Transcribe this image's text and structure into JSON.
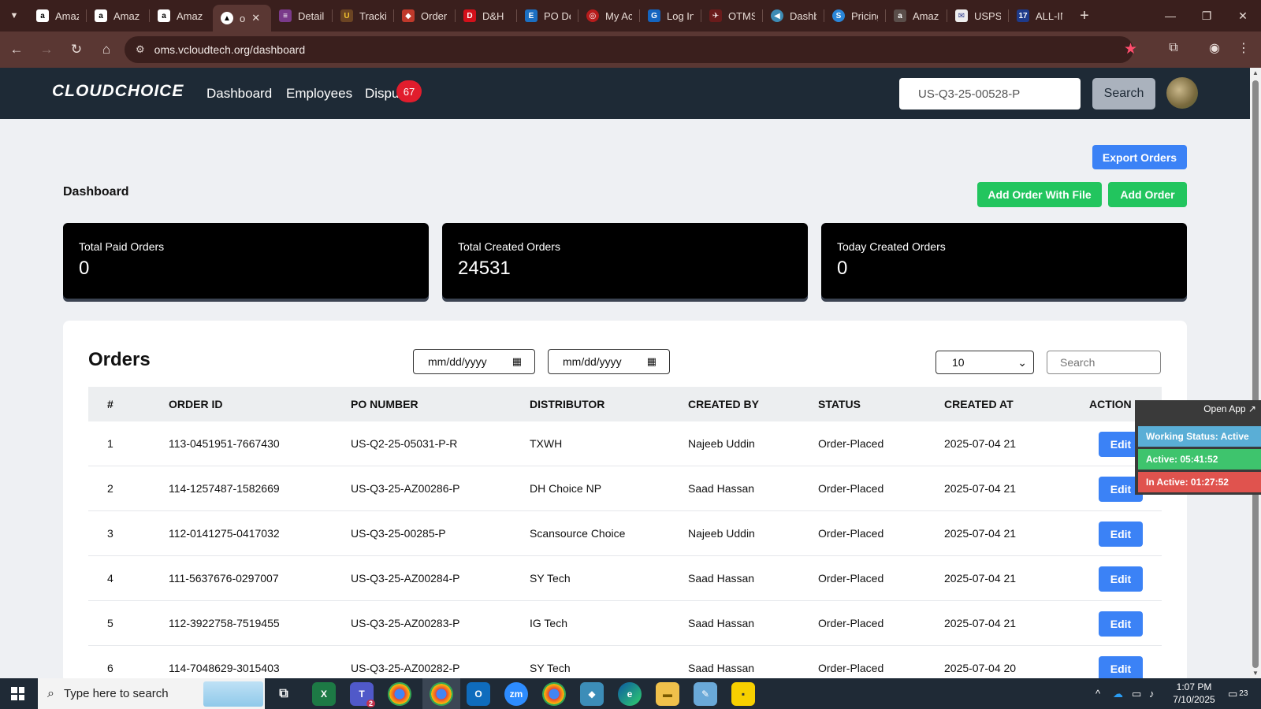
{
  "browser": {
    "tabs": [
      {
        "label": "Amaz",
        "icon": "amazon-icon",
        "active": false
      },
      {
        "label": "Amaz",
        "icon": "amazon-icon",
        "active": false
      },
      {
        "label": "Amaz",
        "icon": "amazon-icon",
        "active": false
      },
      {
        "label": "o",
        "icon": "app-icon",
        "active": true
      },
      {
        "label": "Detail",
        "icon": "detail-icon",
        "active": false
      },
      {
        "label": "Tracki",
        "icon": "ups-icon",
        "active": false
      },
      {
        "label": "Order",
        "icon": "order-icon",
        "active": false
      },
      {
        "label": "D&H",
        "icon": "dh-icon",
        "active": false
      },
      {
        "label": "PO De",
        "icon": "ec-icon",
        "active": false
      },
      {
        "label": "My Ac",
        "icon": "account-icon",
        "active": false
      },
      {
        "label": "Log In",
        "icon": "login-icon",
        "active": false
      },
      {
        "label": "OTMS",
        "icon": "otms-icon",
        "active": false
      },
      {
        "label": "Dashb",
        "icon": "dashboard-icon",
        "active": false
      },
      {
        "label": "Pricing",
        "icon": "pricing-icon",
        "active": false
      },
      {
        "label": "Amaz",
        "icon": "amazon-icon",
        "active": false
      },
      {
        "label": "USPS",
        "icon": "usps-icon",
        "active": false
      },
      {
        "label": "ALL-IN",
        "icon": "seventeen-icon",
        "active": false
      }
    ],
    "url": "oms.vcloudtech.org/dashboard"
  },
  "header": {
    "logo": "CLOUDCHOICE",
    "nav": [
      "Dashboard",
      "Employees",
      "Dispu"
    ],
    "dispute_badge": "67",
    "search_value": "US-Q3-25-00528-P",
    "search_button": "Search"
  },
  "toolbar": {
    "export_label": "Export Orders",
    "add_with_file_label": "Add Order With File",
    "add_label": "Add Order"
  },
  "page_title": "Dashboard",
  "stats": [
    {
      "label": "Total Paid Orders",
      "value": "0"
    },
    {
      "label": "Total Created Orders",
      "value": "24531"
    },
    {
      "label": "Today Created Orders",
      "value": "0"
    }
  ],
  "orders": {
    "title": "Orders",
    "date_from_placeholder": "mm/dd/yyyy",
    "date_to_placeholder": "mm/dd/yyyy",
    "page_size": "10",
    "search_placeholder": "Search",
    "columns": [
      "#",
      "ORDER ID",
      "PO NUMBER",
      "DISTRIBUTOR",
      "CREATED BY",
      "STATUS",
      "CREATED AT",
      "ACTION"
    ],
    "rows": [
      {
        "n": "1",
        "order_id": "113-0451951-7667430",
        "po": "US-Q2-25-05031-P-R",
        "distributor": "TXWH",
        "created_by": "Najeeb Uddin",
        "status": "Order-Placed",
        "created_at": "2025-07-04 21",
        "action": "Edit"
      },
      {
        "n": "2",
        "order_id": "114-1257487-1582669",
        "po": "US-Q3-25-AZ00286-P",
        "distributor": "DH Choice NP",
        "created_by": "Saad Hassan",
        "status": "Order-Placed",
        "created_at": "2025-07-04 21",
        "action": "Edit"
      },
      {
        "n": "3",
        "order_id": "112-0141275-0417032",
        "po": "US-Q3-25-00285-P",
        "distributor": "Scansource Choice",
        "created_by": "Najeeb Uddin",
        "status": "Order-Placed",
        "created_at": "2025-07-04 21",
        "action": "Edit"
      },
      {
        "n": "4",
        "order_id": "111-5637676-0297007",
        "po": "US-Q3-25-AZ00284-P",
        "distributor": "SY Tech",
        "created_by": "Saad Hassan",
        "status": "Order-Placed",
        "created_at": "2025-07-04 21",
        "action": "Edit"
      },
      {
        "n": "5",
        "order_id": "112-3922758-7519455",
        "po": "US-Q3-25-AZ00283-P",
        "distributor": "IG Tech",
        "created_by": "Saad Hassan",
        "status": "Order-Placed",
        "created_at": "2025-07-04 21",
        "action": "Edit"
      },
      {
        "n": "6",
        "order_id": "114-7048629-3015403",
        "po": "US-Q3-25-AZ00282-P",
        "distributor": "SY Tech",
        "created_by": "Saad Hassan",
        "status": "Order-Placed",
        "created_at": "2025-07-04 20",
        "action": "Edit"
      }
    ]
  },
  "widget": {
    "open_label": "Open App ↗",
    "working_status": "Working Status: Active",
    "active": "Active: 05:41:52",
    "inactive": "In Active: 01:27:52"
  },
  "taskbar": {
    "search_placeholder": "Type here to search",
    "time": "1:07 PM",
    "date": "7/10/2025",
    "teams_badge": "2",
    "notification_count": "23"
  },
  "colors": {
    "header_bg": "#1e2a36",
    "primary": "#3b82f6",
    "success": "#22c55e",
    "danger_badge": "#e11d2d",
    "widget_status": "#5aaed6",
    "widget_active": "#3ec46d",
    "widget_inactive": "#e0534e"
  }
}
